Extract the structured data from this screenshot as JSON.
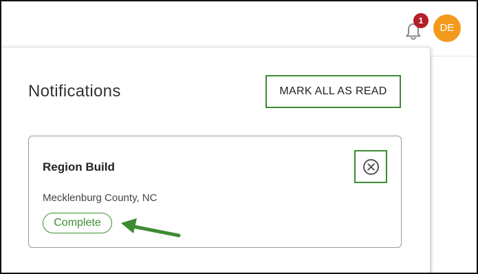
{
  "header": {
    "notifications_icon": "bell-icon",
    "unread_count": "1",
    "user_initials": "DE",
    "colors": {
      "badge": "#b3202a",
      "avatar": "#f39a1c"
    }
  },
  "notifications_panel": {
    "title": "Notifications",
    "mark_all_label": "MARK ALL AS READ",
    "items": [
      {
        "title": "Region Build",
        "location": "Mecklenburg County, NC",
        "status": "Complete",
        "dismiss_icon": "close-circle-icon"
      }
    ]
  },
  "annotation": {
    "highlight_color": "#3d8b32",
    "arrow_icon": "arrow-left-icon"
  }
}
